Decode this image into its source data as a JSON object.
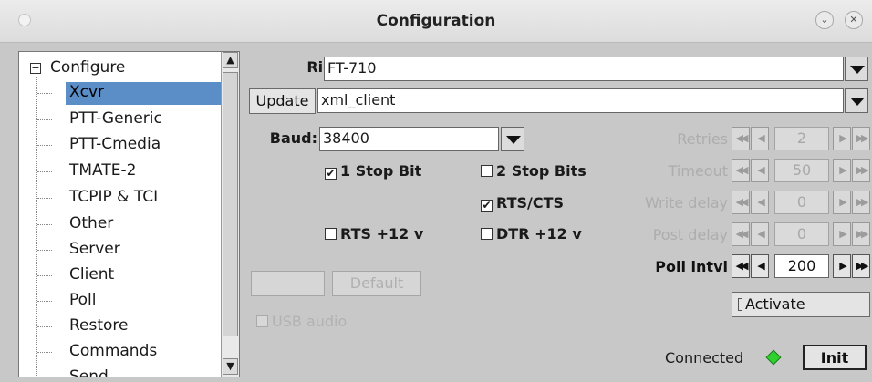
{
  "window": {
    "title": "Configuration",
    "minimize_glyph": "⌄",
    "close_glyph": "✕"
  },
  "tree": {
    "root_label": "Configure",
    "root_toggle": "−",
    "items": [
      {
        "label": "Xcvr",
        "selected": true
      },
      {
        "label": "PTT-Generic"
      },
      {
        "label": "PTT-Cmedia"
      },
      {
        "label": "TMATE-2"
      },
      {
        "label": "TCPIP & TCI"
      },
      {
        "label": "Other"
      },
      {
        "label": "Server"
      },
      {
        "label": "Client"
      },
      {
        "label": "Poll"
      },
      {
        "label": "Restore"
      },
      {
        "label": "Commands"
      },
      {
        "label": "Send"
      }
    ]
  },
  "rig": {
    "label": "Rig:",
    "value": "FT-710"
  },
  "update": {
    "button_label": "Update",
    "value": "xml_client"
  },
  "baud": {
    "label": "Baud:",
    "value": "38400"
  },
  "checks": {
    "stop1": {
      "label": "1 Stop Bit",
      "checked": true
    },
    "stop2": {
      "label": "2 Stop Bits",
      "checked": false
    },
    "rtscts": {
      "label": "RTS/CTS",
      "checked": true
    },
    "rts12": {
      "label": "RTS +12 v",
      "checked": false
    },
    "dtr12": {
      "label": "DTR +12 v",
      "checked": false
    },
    "usb_audio": {
      "label": "USB audio",
      "checked": false
    }
  },
  "default_button": "Default",
  "spinners": {
    "retries": {
      "label": "Retries",
      "value": "2"
    },
    "timeout": {
      "label": "Timeout",
      "value": "50"
    },
    "write_delay": {
      "label": "Write delay",
      "value": "0"
    },
    "post_delay": {
      "label": "Post delay",
      "value": "0"
    },
    "poll_intvl": {
      "label": "Poll intvl",
      "value": "200"
    }
  },
  "activate": {
    "label": "Activate"
  },
  "status": {
    "connected_label": "Connected",
    "init_button": "Init"
  },
  "colors": {
    "selection": "#5b8dc7",
    "led": "#2fd12f"
  }
}
